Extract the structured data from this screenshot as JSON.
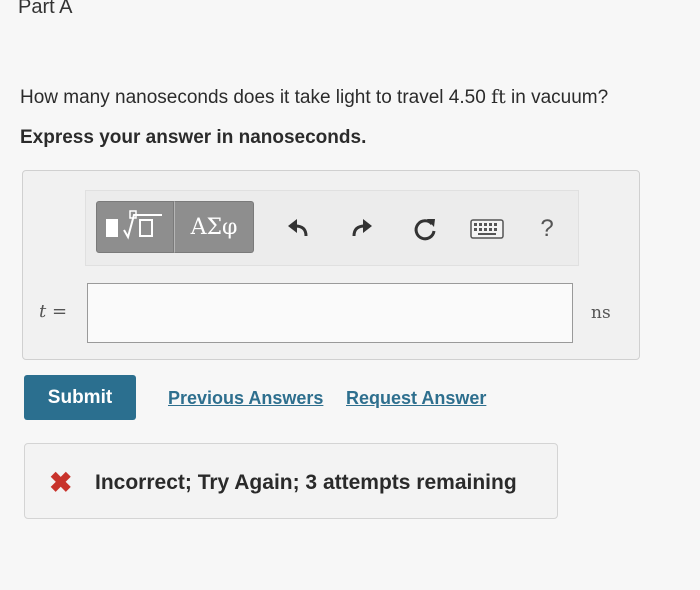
{
  "part": {
    "title": "Part A"
  },
  "question": {
    "text_before": "How many nanoseconds does it take light to travel 4.50 ",
    "unit_inline": "ft",
    "text_after": " in vacuum?",
    "instruction": "Express your answer in nanoseconds."
  },
  "toolbar": {
    "greek_label": "ΑΣφ",
    "help_label": "?",
    "icons": [
      "templates-icon",
      "undo-icon",
      "redo-icon",
      "reset-icon",
      "keyboard-icon",
      "help-icon"
    ]
  },
  "answer": {
    "variable": "t",
    "equals": " =",
    "value": "",
    "unit": "ns"
  },
  "actions": {
    "submit_label": "Submit",
    "previous_answers_label": "Previous Answers",
    "request_answer_label": "Request Answer"
  },
  "feedback": {
    "status": "incorrect",
    "message": "Incorrect; Try Again; 3 attempts remaining"
  },
  "colors": {
    "submit_bg": "#2b6f8f",
    "link": "#2e6f8e",
    "error": "#c8332b",
    "toolbar_button": "#8e8e8e"
  }
}
